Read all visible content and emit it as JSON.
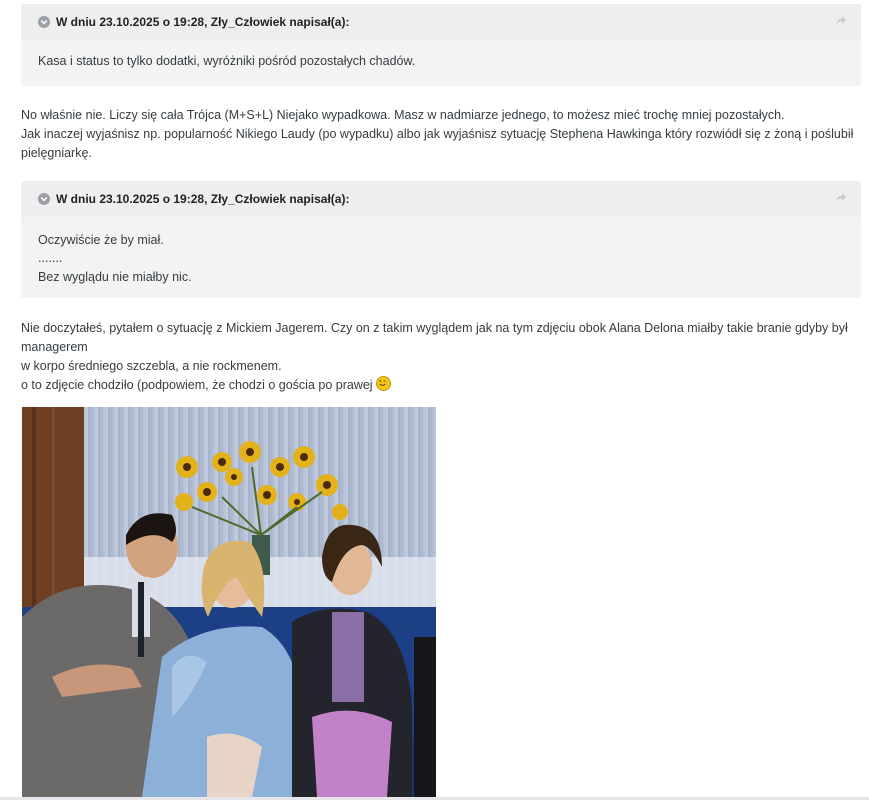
{
  "quote1": {
    "title": "W dniu 23.10.2025 o 19:28, Zły_Człowiek napisał(a):",
    "lines": [
      "Kasa i status to tylko dodatki, wyróżniki pośród pozostałych chadów."
    ]
  },
  "paragraph1": {
    "lines": [
      "No właśnie nie. Liczy się cała Trójca (M+S+L) Niejako wypadkowa. Masz w nadmiarze jednego, to możesz mieć trochę mniej pozostałych.",
      "Jak inaczej wyjaśnisz np. popularność Nikiego Laudy (po wypadku) albo jak wyjaśnisz sytuację Stephena Hawkinga który rozwiódł się z żoną i poślubił",
      "pielęgniarkę."
    ]
  },
  "quote2": {
    "title": "W dniu 23.10.2025 o 19:28, Zły_Człowiek napisał(a):",
    "lines": [
      "Oczywiście że by miał.",
      ".......",
      "Bez wyglądu nie miałby nic."
    ]
  },
  "paragraph2": {
    "lines": [
      "Nie doczytałeś, pytałem o sytuację z Mickiem Jagerem. Czy on z takim wyglądem jak na tym zdjęciu obok Alana Delona miałby takie branie gdyby był managerem",
      "w korpo średniego szczebla, a nie rockmenem.",
      "o to zdjęcie chodziło (podpowiem, że chodzi o gościa po prawej "
    ]
  },
  "colors": {
    "quote_bg": "#f3f3f3",
    "quote_header_bg": "#eeeeee",
    "text": "#353c41"
  },
  "icons": {
    "collapse": "chevron-down-icon",
    "share": "share-arrow-icon",
    "emoji": "wink-emoji-icon"
  }
}
